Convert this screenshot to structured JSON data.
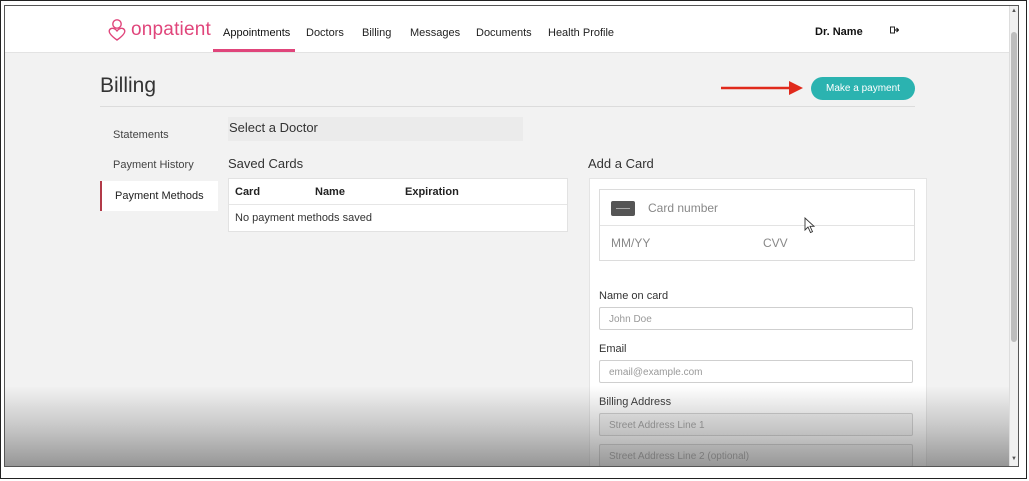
{
  "brand": {
    "name": "onpatient"
  },
  "nav": {
    "items": [
      {
        "label": "Appointments",
        "active": true
      },
      {
        "label": "Doctors"
      },
      {
        "label": "Billing"
      },
      {
        "label": "Messages"
      },
      {
        "label": "Documents"
      },
      {
        "label": "Health Profile"
      }
    ],
    "user_name": "Dr. Name",
    "logout_icon": "logout-icon"
  },
  "page": {
    "title": "Billing",
    "primary_button": "Make a payment"
  },
  "sidebar": {
    "items": [
      {
        "label": "Statements"
      },
      {
        "label": "Payment History"
      },
      {
        "label": "Payment Methods",
        "active": true
      }
    ]
  },
  "select_doctor": {
    "label": "Select a Doctor"
  },
  "saved_cards": {
    "title": "Saved Cards",
    "columns": [
      "Card",
      "Name",
      "Expiration"
    ],
    "empty_text": "No payment methods saved"
  },
  "add_card": {
    "title": "Add a Card",
    "card_number_placeholder": "Card number",
    "expiry_placeholder": "MM/YY",
    "cvv_placeholder": "CVV",
    "name_label": "Name on card",
    "name_placeholder": "John Doe",
    "email_label": "Email",
    "email_placeholder": "email@example.com",
    "billing_label": "Billing Address",
    "street1_placeholder": "Street Address Line 1",
    "street2_placeholder": "Street Address Line 2 (optional)"
  },
  "colors": {
    "brand": "#e0457b",
    "accent": "#2bb3b0",
    "active_sidebar": "#b23a48",
    "arrow": "#e02a1c"
  }
}
